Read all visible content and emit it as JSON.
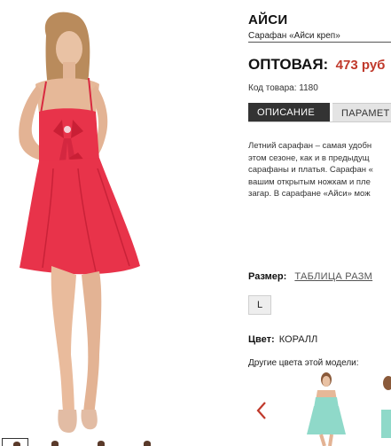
{
  "product": {
    "title": "АЙСИ",
    "subtitle": "Сарафан «Айси креп»",
    "price_label": "ОПТОВАЯ:",
    "price_value": "473 руб",
    "sku_label": "Код товара:",
    "sku_value": "1180"
  },
  "tabs": [
    {
      "label": "ОПИСАНИЕ",
      "active": true
    },
    {
      "label": "ПАРАМЕТ",
      "active": false
    }
  ],
  "description_lines": [
    "Летний сарафан – самая удобн",
    "этом сезоне, как и в предыдущ",
    "сарафаны и платья. Сарафан «",
    "вашим открытым ножкам и пле",
    "загар. В сарафане «Айси» мож"
  ],
  "size": {
    "label": "Размер:",
    "table_link": "ТАБЛИЦА РАЗМ",
    "options": [
      "L"
    ]
  },
  "color": {
    "label": "Цвет:",
    "value": "КОРАЛЛ"
  },
  "other_colors_label": "Другие цвета этой модели:",
  "icons": {
    "carousel_prev": "chevron-left-icon"
  },
  "colors": {
    "accent_price": "#c0392b",
    "dress_main": "#e8334a",
    "dress_alt": "#8fd9c9",
    "tab_active_bg": "#333333"
  }
}
